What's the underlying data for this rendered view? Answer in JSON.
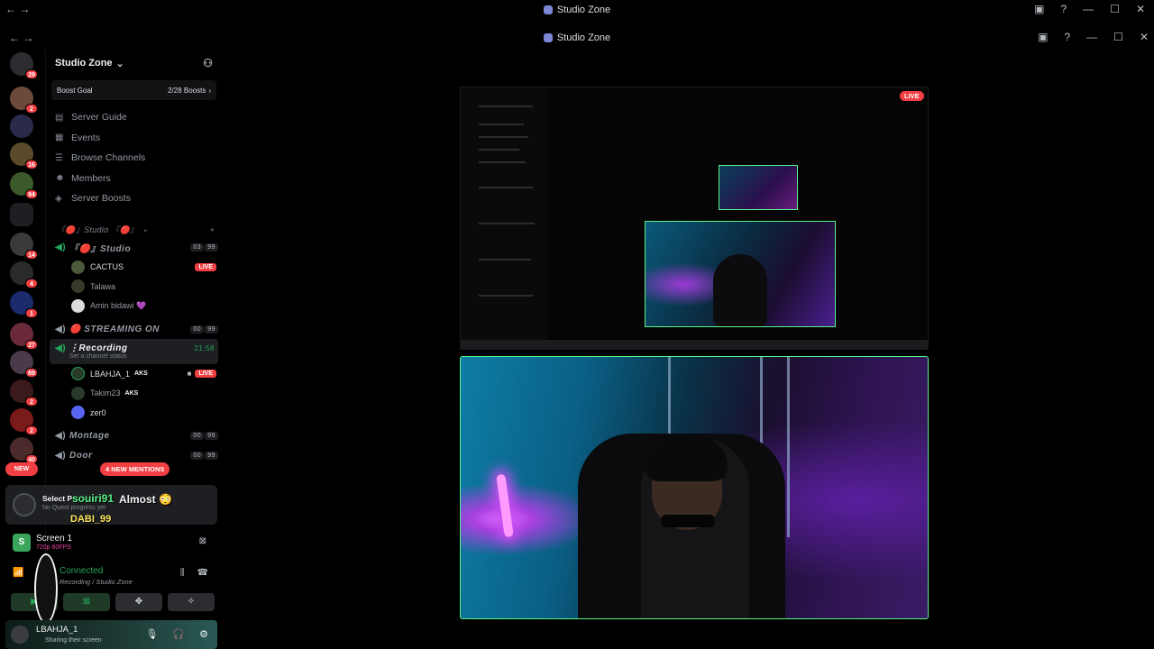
{
  "window": {
    "title": "Studio Zone"
  },
  "inner_window": {
    "title": "Studio Zone"
  },
  "rail": {
    "home_badge": "29",
    "items": [
      {
        "badge": "2"
      },
      {
        "badge": ""
      },
      {
        "badge": "16"
      },
      {
        "badge": "94"
      },
      {
        "badge": ""
      },
      {
        "badge": "14"
      },
      {
        "badge": "4"
      },
      {
        "badge": "1"
      },
      {
        "badge": "27"
      },
      {
        "badge": "69"
      },
      {
        "badge": "2"
      },
      {
        "badge": "2"
      },
      {
        "badge": "40"
      }
    ],
    "new_label": "NEW"
  },
  "server": {
    "name": "Studio Zone",
    "boost_goal_label": "Boost Goal",
    "boost_count": "2/28 Boosts",
    "menu": [
      "Server Guide",
      "Events",
      "Browse Channels",
      "Members",
      "Server Boosts"
    ],
    "category": "『🔴』Studio 『🔴』",
    "channels": {
      "studio": {
        "name": "『🔴』Studio",
        "counts": [
          "03",
          "99"
        ]
      },
      "streaming": {
        "name": "🔴 STREAMING ON",
        "counts": [
          "00",
          "99"
        ]
      },
      "recording": {
        "name": "⋮Recording",
        "time": "21:58",
        "status": "Set a channel status"
      },
      "montage": {
        "name": "Montage",
        "counts": [
          "00",
          "99"
        ]
      },
      "door": {
        "name": "Door",
        "counts": [
          "00",
          "99"
        ]
      }
    },
    "studio_members": [
      {
        "name": "CACTUS",
        "live": "LIVE"
      },
      {
        "name": "Talawa",
        "live": ""
      },
      {
        "name": "Amin bidawi 💜",
        "live": ""
      }
    ],
    "recording_members": [
      {
        "name": "LBAHJA_1",
        "tag": "AKS",
        "live": "LIVE"
      },
      {
        "name": "Takim23",
        "tag": "AKS",
        "live": ""
      },
      {
        "name": "zer0",
        "tag": "",
        "live": ""
      }
    ],
    "mentions": "4 NEW MENTIONS"
  },
  "quest": {
    "title": "Select P",
    "subtitle": "No Quest progress yet"
  },
  "overlay": {
    "user1": "souiri91",
    "msg1": "Almost 😳",
    "user2": "DABI_99"
  },
  "screen_share": {
    "name": "Screen 1",
    "quality": "720p 60FPS",
    "icon_letter": "S"
  },
  "voice": {
    "status": "Connected",
    "location": "Recording / Studio Zone"
  },
  "user": {
    "name": "LBAHJA_1",
    "status": "Sharing their screen"
  },
  "stream": {
    "live_label": "LIVE"
  },
  "colors": {
    "accent_green": "#23a559",
    "live_red": "#f23f43",
    "bg": "#000000"
  }
}
